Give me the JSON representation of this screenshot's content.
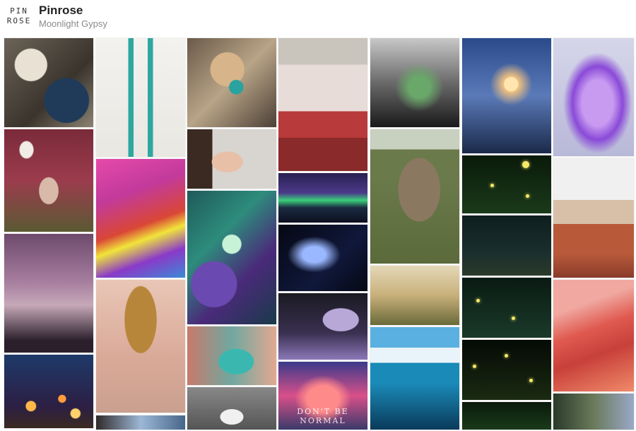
{
  "header": {
    "logo_line1": "PIN",
    "logo_line2": "ROSE",
    "title": "Pinrose",
    "subtitle": "Moonlight Gypsy"
  },
  "tiles": {
    "c6_t4_text": "DON'T BE NORMAL"
  }
}
